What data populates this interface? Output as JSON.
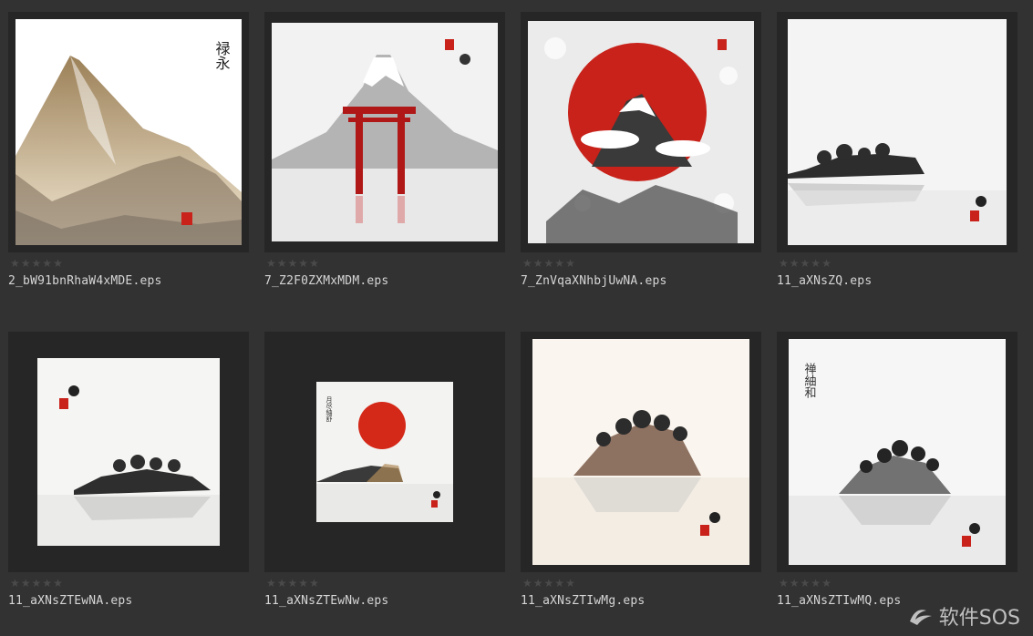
{
  "files": [
    {
      "name": "2_bW91bnRhaW4xMDE.eps",
      "rating": 0,
      "stamp_text": "禄永"
    },
    {
      "name": "7_Z2F0ZXMxMDM.eps",
      "rating": 0
    },
    {
      "name": "7_ZnVqaXNhbjUwNA.eps",
      "rating": 0
    },
    {
      "name": "11_aXNsZQ.eps",
      "rating": 0
    },
    {
      "name": "11_aXNsZTEwNA.eps",
      "rating": 0
    },
    {
      "name": "11_aXNsZTEwNw.eps",
      "rating": 0,
      "stamp_text": "月尽紬舒"
    },
    {
      "name": "11_aXNsZTIwMg.eps",
      "rating": 0
    },
    {
      "name": "11_aXNsZTIwMQ.eps",
      "rating": 0,
      "stamp_text": "禅紬和"
    }
  ],
  "rating_max": 5,
  "watermark": {
    "text": "软件SOS"
  },
  "colors": {
    "background": "#323232",
    "frame": "#262626",
    "accent_red": "#c8221a",
    "star_empty": "#4a4a4a"
  }
}
